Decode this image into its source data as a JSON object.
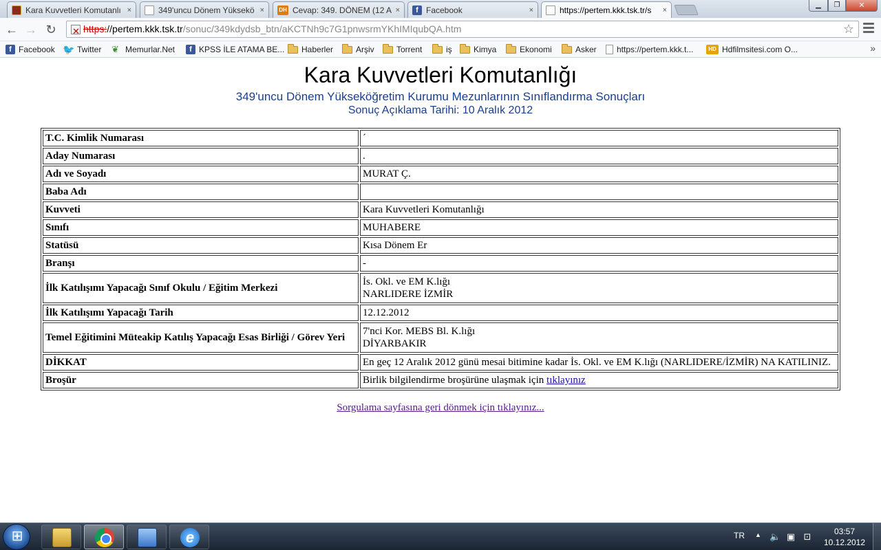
{
  "browser": {
    "tabs": [
      {
        "title": "Kara Kuvvetleri Komutanlı",
        "icon": "kkk-emblem-icon",
        "active": false
      },
      {
        "title": "349'uncu Dönem Yüksekö",
        "icon": "page-icon",
        "active": false
      },
      {
        "title": "Cevap: 349. DÖNEM (12 A",
        "icon": "dh-icon",
        "active": false
      },
      {
        "title": "Facebook",
        "icon": "facebook-icon",
        "active": false
      },
      {
        "title": "https://pertem.kkk.tsk.tr/s",
        "icon": "page-icon",
        "active": true
      }
    ],
    "tab_close_glyph": "×",
    "fav_labels": {
      "dh": "DH",
      "fb": "f"
    },
    "window_close_glyph": "✕",
    "address": {
      "scheme": "https:",
      "separator": "//",
      "host": "pertem.kkk.tsk.tr",
      "path": "/sonuc/349kdydsb_btn/aKCTNh9c7G1pnwsrmYKhIMIqubQA.htm"
    },
    "bookmarks": [
      {
        "label": "Facebook",
        "icon": "facebook-icon"
      },
      {
        "label": "Twitter",
        "icon": "twitter-icon"
      },
      {
        "label": "Memurlar.Net",
        "icon": "memurlar-icon"
      },
      {
        "label": "KPSS İLE ATAMA BE...",
        "icon": "facebook-icon"
      },
      {
        "label": "Haberler",
        "icon": "folder-icon"
      },
      {
        "label": "Arşiv",
        "icon": "folder-icon"
      },
      {
        "label": "Torrent",
        "icon": "folder-icon"
      },
      {
        "label": "iş",
        "icon": "folder-icon"
      },
      {
        "label": "Kimya",
        "icon": "folder-icon"
      },
      {
        "label": "Ekonomi",
        "icon": "folder-icon"
      },
      {
        "label": "Asker",
        "icon": "folder-icon"
      },
      {
        "label": "https://pertem.kkk.t...",
        "icon": "page-icon"
      },
      {
        "label": "Hdfilmsitesi.com O...",
        "icon": "hd-film-icon"
      }
    ],
    "bookmarks_more": "»",
    "hd_icon_label": "HD"
  },
  "page": {
    "title": "Kara Kuvvetleri Komutanlığı",
    "subtitle": "349'uncu Dönem Yükseköğretim Kurumu Mezunlarının Sınıflandırma Sonuçları",
    "date_line": "Sonuç Açıklama Tarihi: 10 Aralık 2012",
    "rows": [
      {
        "label": "T.C. Kimlik Numarası",
        "value": "´",
        "value2": ""
      },
      {
        "label": "Aday Numarası",
        "value": ".",
        "value2": ""
      },
      {
        "label": "Adı ve Soyadı",
        "value": "MURAT Ç.",
        "value2": ""
      },
      {
        "label": "Baba Adı",
        "value": "",
        "value2": ""
      },
      {
        "label": "Kuvveti",
        "value": "Kara Kuvvetleri Komutanlığı",
        "value2": ""
      },
      {
        "label": "Sınıfı",
        "value": "MUHABERE",
        "value2": ""
      },
      {
        "label": "Statüsü",
        "value": "Kısa Dönem Er",
        "value2": ""
      },
      {
        "label": "Branşı",
        "value": "-",
        "value2": ""
      },
      {
        "label": "İlk Katılışımı Yapacağı Sınıf Okulu / Eğitim Merkezi",
        "value": "İs. Okl. ve EM K.lığı",
        "value2": "NARLIDERE İZMİR"
      },
      {
        "label": "İlk Katılışımı Yapacağı Tarih",
        "value": "12.12.2012",
        "value2": ""
      },
      {
        "label": "Temel Eğitimini Müteakip Katılış Yapacağı Esas Birliği / Görev Yeri",
        "value": "7'nci Kor. MEBS Bl. K.lığı",
        "value2": "DİYARBAKIR"
      },
      {
        "label": "DİKKAT",
        "value": "En geç 12 Aralık 2012 günü mesai bitimine kadar İs. Okl. ve EM K.lığı (NARLIDERE/İZMİR) NA KATILINIZ.",
        "value2": ""
      },
      {
        "label": "Broşür",
        "value": "Birlik bilgilendirme broşürüne ulaşmak için",
        "value2": ""
      }
    ],
    "brochure_link": "tıklayınız",
    "back_link": "Sorgulama sayfasına geri dönmek için tıklayınız..."
  },
  "taskbar": {
    "apps": [
      {
        "name": "windows-explorer",
        "active": false
      },
      {
        "name": "google-chrome",
        "active": true
      },
      {
        "name": "display-settings",
        "active": false
      },
      {
        "name": "internet-explorer",
        "active": false
      }
    ],
    "ie_label": "e",
    "language": "TR",
    "tray_arrow": "▲",
    "time": "03:57",
    "date": "10.12.2012"
  }
}
